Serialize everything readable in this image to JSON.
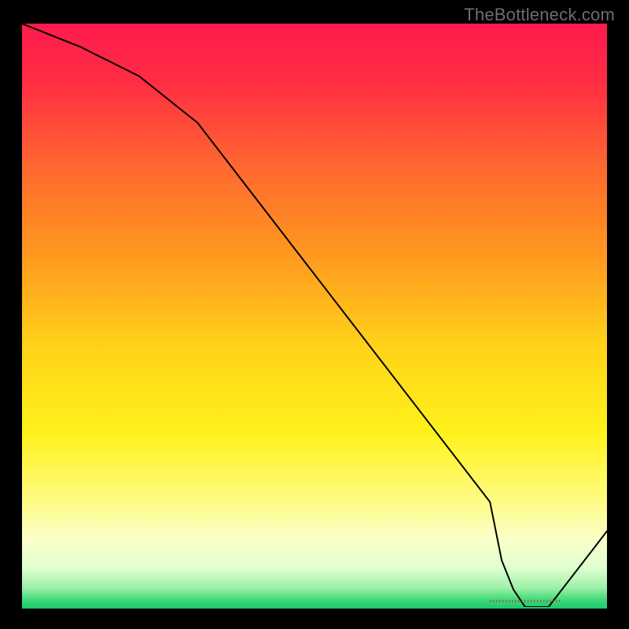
{
  "watermark": "TheBottleneck.com",
  "chart_data": {
    "type": "line",
    "title": "",
    "xlabel": "",
    "ylabel": "",
    "x": [
      0,
      10,
      20,
      30,
      40,
      50,
      60,
      70,
      80,
      82,
      84,
      86,
      88,
      90,
      100
    ],
    "values": [
      100,
      96,
      91,
      83,
      70,
      57,
      44,
      31,
      18,
      8,
      3,
      0,
      0,
      0,
      13
    ],
    "xlim": [
      0,
      100
    ],
    "ylim": [
      0,
      100
    ],
    "curve_color": "#000000",
    "optimal_range": {
      "x_start": 80,
      "x_end": 92,
      "y": 1,
      "color": "#d02a2a"
    },
    "gradient_stops": [
      {
        "offset": 0.0,
        "color": "#ff1a4e"
      },
      {
        "offset": 0.1,
        "color": "#ff2d43"
      },
      {
        "offset": 0.25,
        "color": "#ff6a2f"
      },
      {
        "offset": 0.4,
        "color": "#ff9a1f"
      },
      {
        "offset": 0.55,
        "color": "#ffd21a"
      },
      {
        "offset": 0.7,
        "color": "#fff21a"
      },
      {
        "offset": 0.82,
        "color": "#fffc88"
      },
      {
        "offset": 0.88,
        "color": "#fcffc8"
      },
      {
        "offset": 0.93,
        "color": "#e0ffd0"
      },
      {
        "offset": 0.965,
        "color": "#9df0a8"
      },
      {
        "offset": 0.985,
        "color": "#3fd97a"
      },
      {
        "offset": 1.0,
        "color": "#1cc96e"
      }
    ]
  }
}
